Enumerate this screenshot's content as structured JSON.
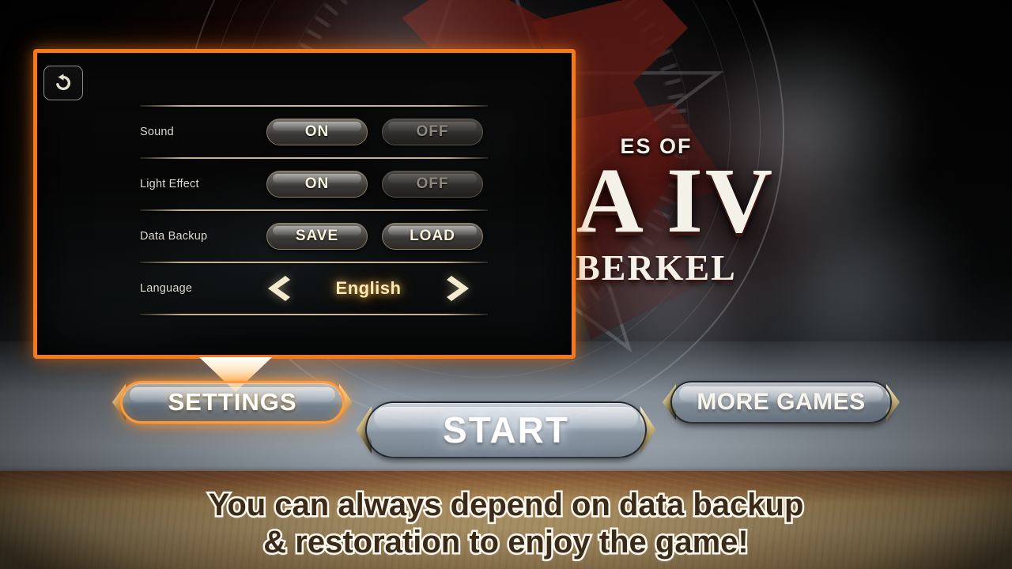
{
  "background": {
    "game_title_small": "ES OF",
    "game_title_main": "IA IV",
    "game_title_sub": "BERKEL"
  },
  "settings_panel": {
    "restore_icon": "restore-arrow-icon",
    "rows": [
      {
        "label": "Sound",
        "type": "toggle",
        "options": [
          "ON",
          "OFF"
        ],
        "selected": "ON"
      },
      {
        "label": "Light Effect",
        "type": "toggle",
        "options": [
          "ON",
          "OFF"
        ],
        "selected": "ON"
      },
      {
        "label": "Data Backup",
        "type": "actions",
        "options": [
          "SAVE",
          "LOAD"
        ],
        "selected": ""
      },
      {
        "label": "Language",
        "type": "stepper",
        "value": "English",
        "prev_icon": "chevron-left-icon",
        "next_icon": "chevron-right-icon"
      }
    ]
  },
  "menu": {
    "settings_label": "SETTINGS",
    "start_label": "START",
    "more_games_label": "MORE GAMES"
  },
  "caption": {
    "line1": "You can always depend on data backup",
    "line2": "& restoration to enjoy the game!"
  },
  "colors": {
    "panel_border_orange": "#f5791c",
    "separator_tan": "#cdbb96",
    "language_gold": "#ffe9b5",
    "caption_brown": "#3b2a18",
    "caption_outline": "#fdf8ee"
  }
}
